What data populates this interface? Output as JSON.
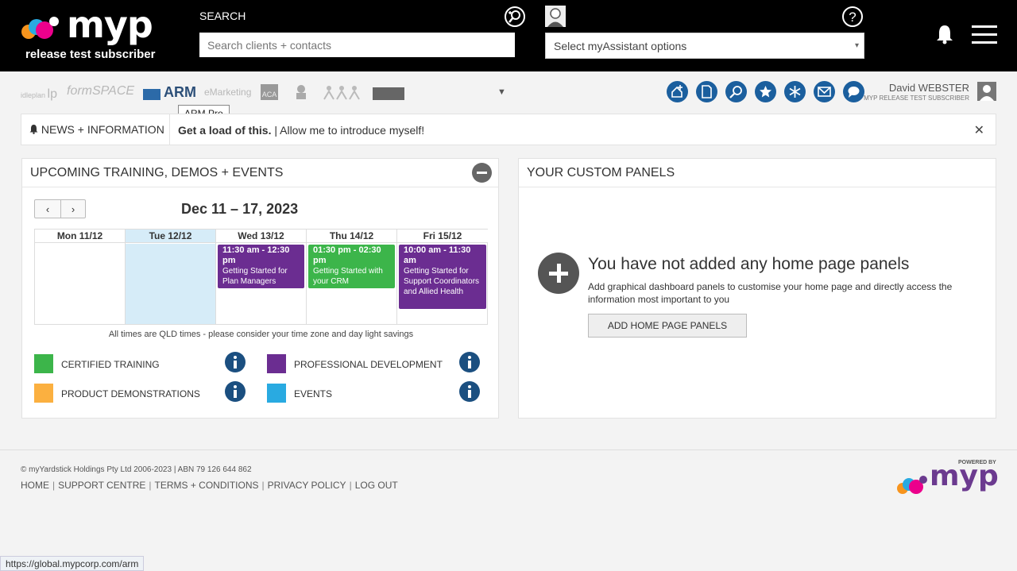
{
  "header": {
    "logo_text": "myp",
    "subscriber": "release test subscriber",
    "search_label": "SEARCH",
    "search_placeholder": "Search clients + contacts",
    "assistant_placeholder": "Select myAssistant options",
    "assistant_caret": "▾"
  },
  "products": {
    "items": [
      {
        "label": "idleplan",
        "icon": "ideplan-logo"
      },
      {
        "label": "formSPACE",
        "icon": "formspace-logo"
      },
      {
        "label": "ARM",
        "icon": "arm-logo"
      },
      {
        "label": "eMarketing",
        "icon": "emarketing-logo"
      },
      {
        "label": "ACA",
        "icon": "aca-logo"
      },
      {
        "label": "",
        "icon": "person-logo"
      },
      {
        "label": "",
        "icon": "people-logo"
      },
      {
        "label": "",
        "icon": "dark-badge-logo"
      }
    ],
    "tooltip": "ARM Pro",
    "more_caret": "▼"
  },
  "quick_actions": [
    "home-plus-icon",
    "document-icon",
    "search-plus-icon",
    "star-icon",
    "snowflake-icon",
    "mail-icon",
    "chat-icon"
  ],
  "user": {
    "name": "David WEBSTER",
    "subscriber": "MYP RELEASE TEST SUBSCRIBER"
  },
  "news": {
    "label": "NEWS + INFORMATION",
    "headline": "Get a load of this.",
    "separator": "|",
    "message": "Allow me to introduce myself!",
    "close": "✕"
  },
  "training_panel": {
    "title": "UPCOMING TRAINING, DEMOS + EVENTS",
    "prev": "‹",
    "next": "›",
    "range": "Dec 11 – 17, 2023",
    "days": [
      {
        "label": "Mon 11/12"
      },
      {
        "label": "Tue 12/12",
        "today": true
      },
      {
        "label": "Wed 13/12"
      },
      {
        "label": "Thu 14/12"
      },
      {
        "label": "Fri 15/12"
      }
    ],
    "events": [
      {
        "day": 2,
        "time": "11:30 am - 12:30 pm",
        "title": "Getting Started for Plan Managers",
        "color": "#6b2d91"
      },
      {
        "day": 3,
        "time": "01:30 pm - 02:30 pm",
        "title": "Getting Started with your CRM",
        "color": "#3cb54a"
      },
      {
        "day": 4,
        "time": "10:00 am - 11:30 am",
        "title": "Getting Started for Support Coordinators and Allied Health",
        "color": "#6b2d91"
      }
    ],
    "tz_note": "All times are QLD times - please consider your time zone and day light savings",
    "legend": [
      {
        "label": "CERTIFIED TRAINING",
        "color": "#3cb54a"
      },
      {
        "label": "PROFESSIONAL DEVELOPMENT",
        "color": "#6b2d91"
      },
      {
        "label": "PRODUCT DEMONSTRATIONS",
        "color": "#fbb040"
      },
      {
        "label": "EVENTS",
        "color": "#29aae1"
      }
    ]
  },
  "custom_panel": {
    "title": "YOUR CUSTOM PANELS",
    "empty_title": "You have not added any home page panels",
    "empty_desc": "Add graphical dashboard panels to customise your home page and directly access the information most important to you",
    "button": "ADD HOME PAGE PANELS"
  },
  "footer": {
    "copyright": "© myYardstick Holdings Pty Ltd 2006-2023 | ABN 79 126 644 862",
    "links": [
      "HOME",
      "SUPPORT CENTRE",
      "TERMS + CONDITIONS",
      "PRIVACY POLICY",
      "LOG OUT"
    ],
    "powered_by": "POWERED BY",
    "logo_text": "myp"
  },
  "status_url": "https://global.mypcorp.com/arm"
}
